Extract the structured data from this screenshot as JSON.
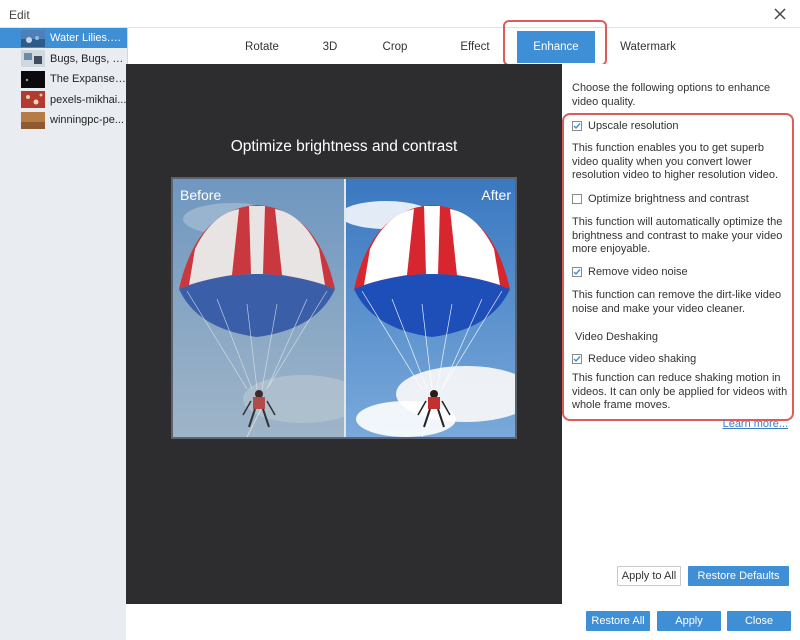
{
  "window": {
    "title": "Edit"
  },
  "files": [
    {
      "name": "Water Lilies.m...",
      "active": true
    },
    {
      "name": "Bugs, Bugs, G...",
      "active": false
    },
    {
      "name": "The Expanse_...",
      "active": false
    },
    {
      "name": "pexels-mikhai...",
      "active": false
    },
    {
      "name": "winningpc-pe...",
      "active": false
    }
  ],
  "tabs": [
    {
      "label": "Rotate"
    },
    {
      "label": "3D"
    },
    {
      "label": "Crop"
    },
    {
      "label": "Effect"
    },
    {
      "label": "Enhance"
    },
    {
      "label": "Watermark"
    }
  ],
  "preview": {
    "title": "Optimize brightness and contrast",
    "before_label": "Before",
    "after_label": "After"
  },
  "panel": {
    "intro": "Choose the following options to enhance video quality.",
    "options": [
      {
        "label": "Upscale resolution",
        "checked": true,
        "description": "This function enables you to get superb video quality when you convert lower resolution video to higher resolution video."
      },
      {
        "label": "Optimize brightness and contrast",
        "checked": false,
        "description": "This function will automatically optimize the brightness and contrast to make your video more enjoyable."
      },
      {
        "label": "Remove video noise",
        "checked": true,
        "description": "This function can remove the dirt-like video noise and make your video cleaner."
      }
    ],
    "deshaking": {
      "section_label": "Video Deshaking",
      "label": "Reduce video shaking",
      "checked": true,
      "description": "This function can reduce shaking motion in videos. It can only be applied for videos with whole frame moves."
    },
    "learn_more": "Learn more...",
    "apply_to_all": "Apply to All",
    "restore_defaults": "Restore Defaults"
  },
  "footer": {
    "restore_all": "Restore All",
    "apply": "Apply",
    "close": "Close"
  },
  "colors": {
    "accent": "#3e8fd6",
    "highlight": "#e05a5a",
    "preview_bg": "#2d2d2f",
    "sidebar_bg": "#e9ecf1"
  }
}
